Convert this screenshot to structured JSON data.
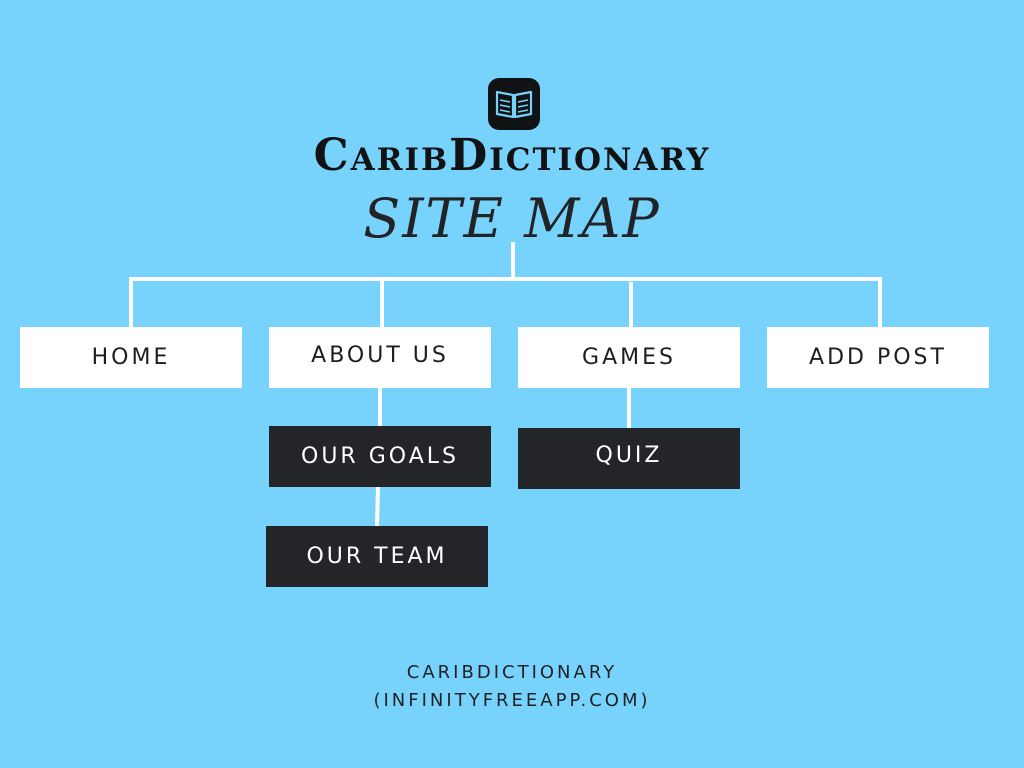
{
  "brand": {
    "icon": "book-icon",
    "name": "CaribDictionary",
    "subtitle": "SITE MAP"
  },
  "nodes": {
    "home": "HOME",
    "about_us": "ABOUT US",
    "games": "GAMES",
    "add_post": "ADD POST",
    "our_goals": "OUR GOALS",
    "quiz": "QUIZ",
    "our_team": "OUR TEAM"
  },
  "footer": {
    "line1": "CARIBDICTIONARY",
    "line2": "(INFINITYFREEAPP.COM)"
  },
  "colors": {
    "background": "#77d3fb",
    "primary_box": "#ffffff",
    "secondary_box": "#242529",
    "connector": "#ffffff"
  }
}
